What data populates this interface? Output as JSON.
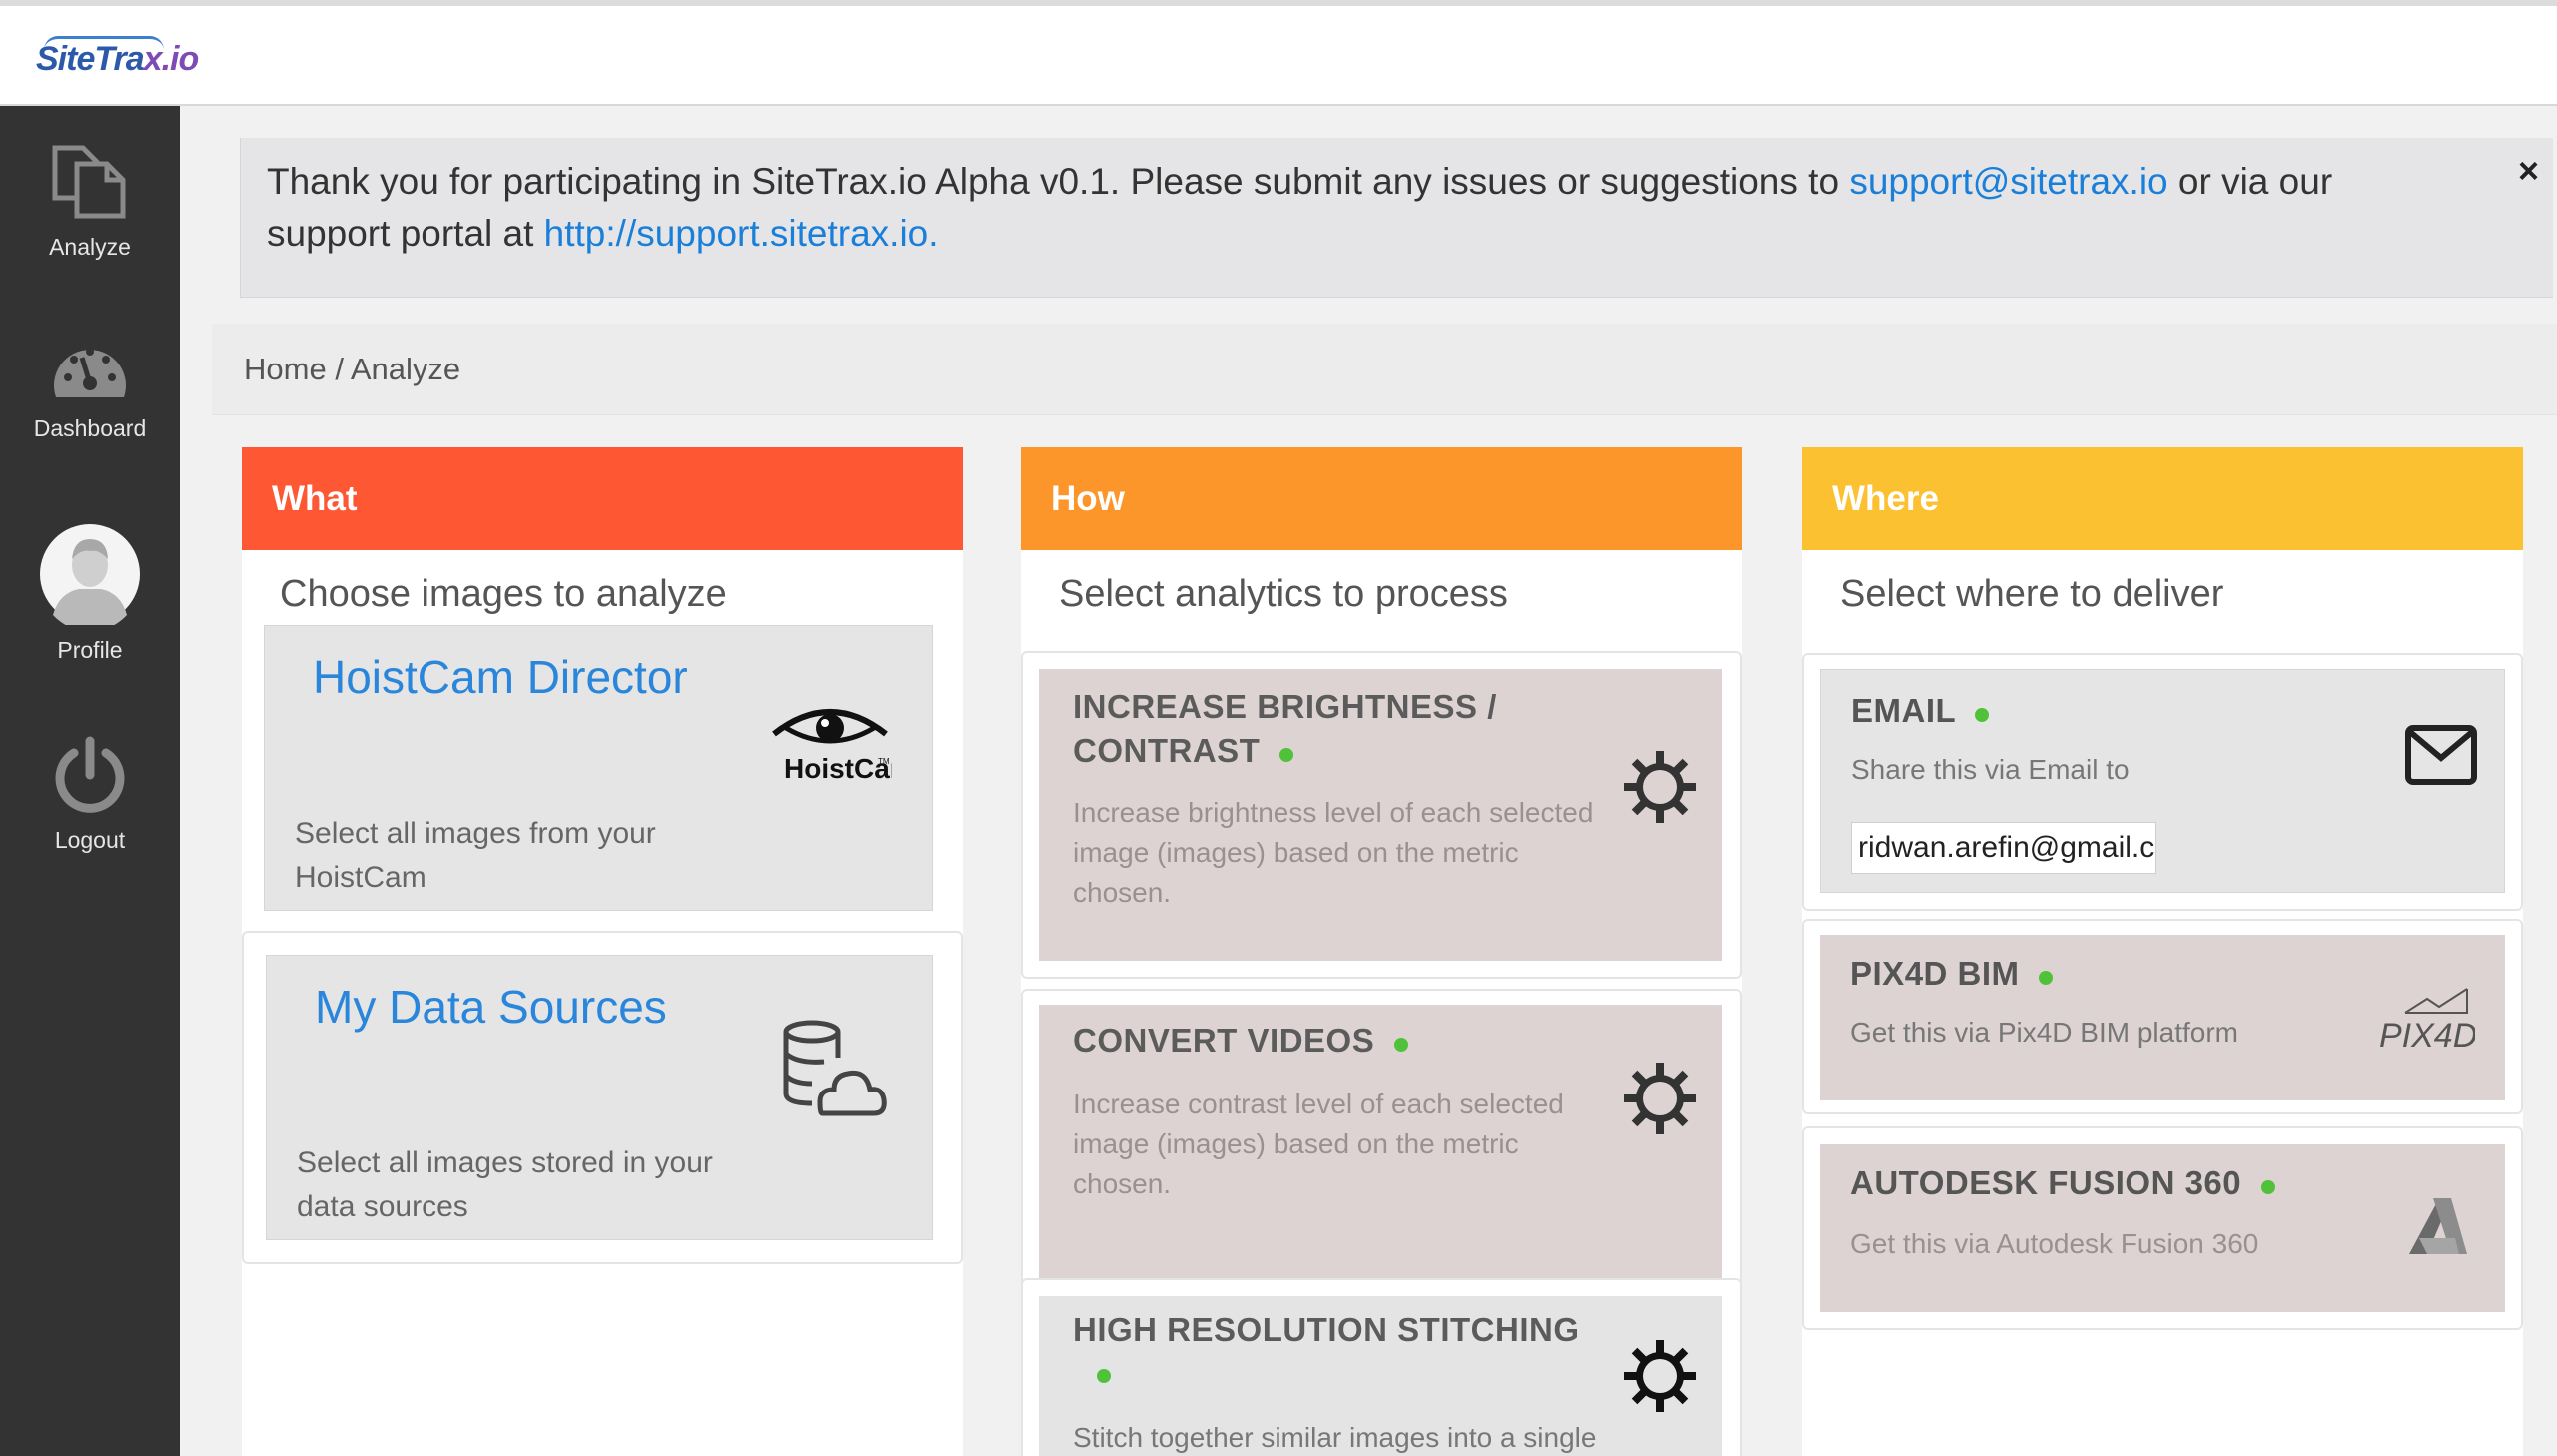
{
  "app": {
    "logo_part1": "SiteTra",
    "logo_part2": "x.io"
  },
  "sidebar": {
    "items": [
      {
        "label": "Analyze",
        "icon": "copy-pages-icon"
      },
      {
        "label": "Dashboard",
        "icon": "speedometer-icon"
      },
      {
        "label": "Profile",
        "icon": "avatar"
      },
      {
        "label": "Logout",
        "icon": "power-icon"
      }
    ]
  },
  "banner": {
    "text_before": "Thank you for participating in SiteTrax.io Alpha v0.1. Please submit any issues or suggestions to ",
    "email_link": "support@sitetrax.io",
    "text_middle": " or via our support portal at ",
    "portal_link": "http://support.sitetrax.io.",
    "close": "×"
  },
  "breadcrumb": {
    "home": "Home",
    "sep": " / ",
    "current": "Analyze"
  },
  "what": {
    "header": "What",
    "subtitle": "Choose images to analyze",
    "color": "#fe5733",
    "sources": [
      {
        "title": "HoistCam Director",
        "desc_line1": "Select all images from your",
        "desc_line2": "HoistCam",
        "logo_text": "HoistCam",
        "logo_tm": "TM"
      },
      {
        "title": "My Data Sources",
        "desc_line1": "Select all images stored in your",
        "desc_line2": "data sources"
      }
    ]
  },
  "how": {
    "header": "How",
    "subtitle": "Select analytics to process",
    "color": "#fd962a",
    "analytics": [
      {
        "title_line1": "INCREASE BRIGHTNESS /",
        "title_line2": "CONTRAST",
        "desc_line1": "Increase brightness level of each selected",
        "desc_line2": "image (images) based on the metric",
        "desc_line3": "chosen."
      },
      {
        "title_line1": "CONVERT VIDEOS",
        "desc_line1": "Increase contrast level of each selected",
        "desc_line2": "image (images) based on the metric",
        "desc_line3": "chosen."
      },
      {
        "title_line1": "HIGH RESOLUTION STITCHING",
        "desc_line1": "Stitch together similar images into a single"
      }
    ]
  },
  "where": {
    "header": "Where",
    "subtitle": "Select where to deliver",
    "color": "#fcc131",
    "destinations": [
      {
        "title": "EMAIL",
        "desc": "Share this via Email to",
        "input_value": "ridwan.arefin@gmail.com"
      },
      {
        "title": "PIX4D BIM",
        "desc": "Get this via Pix4D BIM platform",
        "logo_text": "PIX4D"
      },
      {
        "title": "AUTODESK FUSION 360",
        "desc": "Get this via Autodesk Fusion 360"
      }
    ]
  },
  "colors": {
    "sidebar": "#333333",
    "link": "#1a7fd8",
    "status_green": "#4fc23a"
  }
}
